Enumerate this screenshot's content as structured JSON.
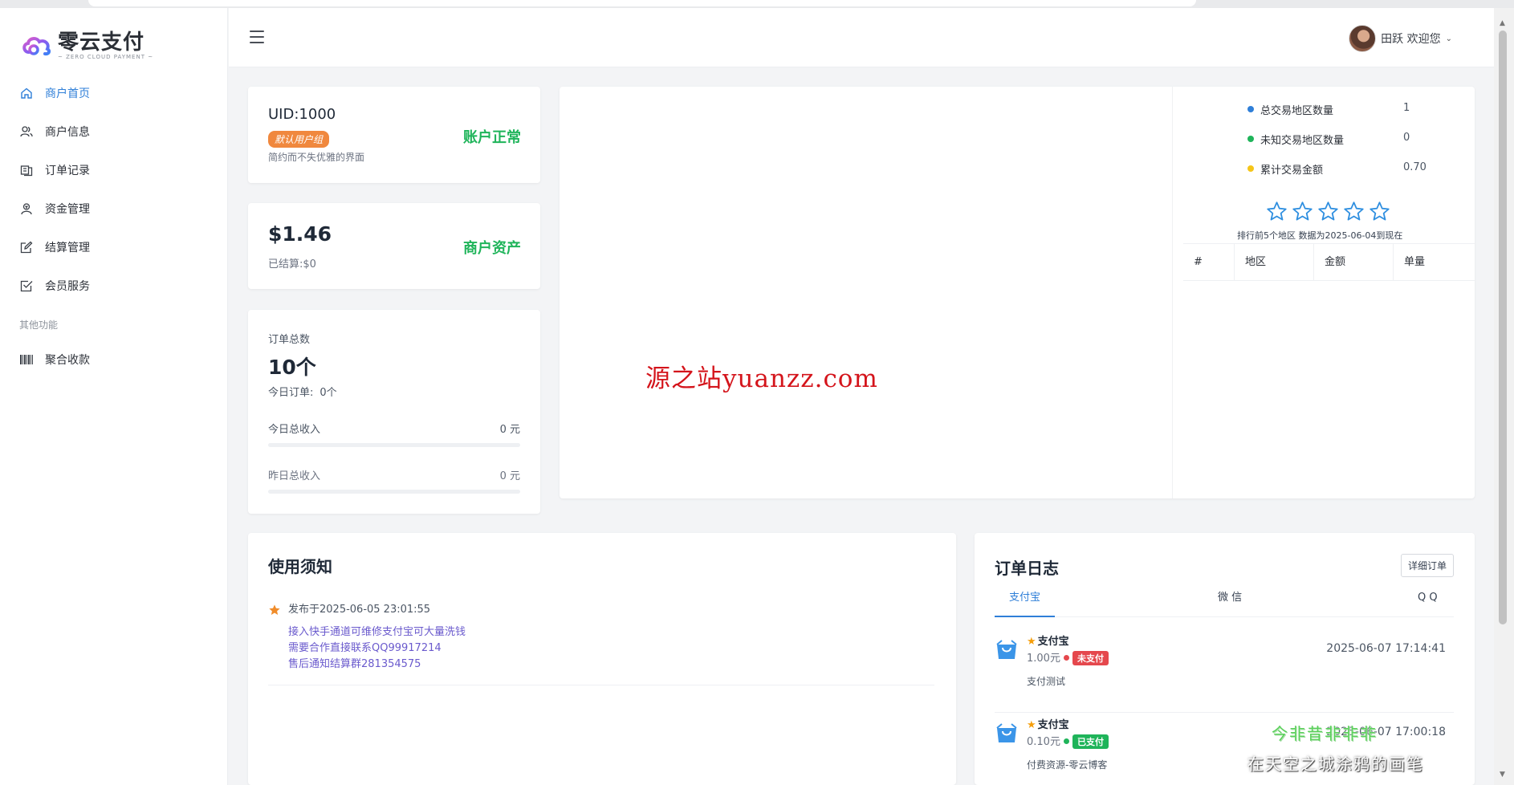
{
  "brand": {
    "name": "零云支付",
    "subtitle": "ZERO CLOUD PAYMENT",
    "accent": "#2f7fd8"
  },
  "sidebar": {
    "items": [
      {
        "label": "商户首页",
        "icon": "home-icon",
        "active": true
      },
      {
        "label": "商户信息",
        "icon": "users-icon"
      },
      {
        "label": "订单记录",
        "icon": "records-icon"
      },
      {
        "label": "资金管理",
        "icon": "funds-icon"
      },
      {
        "label": "结算管理",
        "icon": "edit-icon"
      },
      {
        "label": "会员服务",
        "icon": "checkbox-icon"
      }
    ],
    "section_label": "其他功能",
    "extra_items": [
      {
        "label": "聚合收款",
        "icon": "barcode-icon"
      }
    ]
  },
  "header": {
    "user_greeting": "田跃 欢迎您"
  },
  "account": {
    "uid": "UID:1000",
    "group_badge": "默认用户组",
    "description": "简约而不失优雅的界面",
    "status": "账户正常"
  },
  "asset": {
    "balance": "$1.46",
    "settled": "已结算:$0",
    "label": "商户资产"
  },
  "orders": {
    "total_label": "订单总数",
    "total_value": "10个",
    "today_label": "今日订单:",
    "today_value": "0个",
    "today_income_label": "今日总收入",
    "today_income_value": "0 元",
    "yesterday_income_label": "昨日总收入",
    "yesterday_income_value": "0 元"
  },
  "region_stats": {
    "rows": [
      {
        "label": "总交易地区数量",
        "value": "1",
        "color": "#2f7fd8"
      },
      {
        "label": "未知交易地区数量",
        "value": "0",
        "color": "#1fb45a"
      },
      {
        "label": "累计交易金额",
        "value": "0.70",
        "color": "#f5c518"
      }
    ],
    "rank_note": "排行前5个地区  数据为2025-06-04到现在",
    "table_headers": [
      "#",
      "地区",
      "金额",
      "单量"
    ],
    "star_count": 5
  },
  "watermarks": {
    "site": "源之站yuanzz.com",
    "overlay_1": "今非昔非非非",
    "overlay_2": "在天空之城涂鸦的画笔"
  },
  "notice": {
    "title": "使用须知",
    "date": "发布于2025-06-05 23:01:55",
    "lines": [
      "接入快手通道可维修支付宝可大量洗钱",
      "需要合作直接联系QQ99917214",
      "售后通知结算群281354575"
    ]
  },
  "order_log": {
    "title": "订单日志",
    "detail_button": "详细订单",
    "tabs": [
      "支付宝",
      "微 信",
      "Q Q"
    ],
    "entries": [
      {
        "name": "支付宝",
        "amount": "1.00元",
        "status": "未支付",
        "status_color": "#e5484d",
        "desc": "支付测试",
        "time": "2025-06-07 17:14:41"
      },
      {
        "name": "支付宝",
        "amount": "0.10元",
        "status": "已支付",
        "status_color": "#1fb45a",
        "desc": "付费资源-零云博客",
        "time": "2025-06-07 17:00:18"
      }
    ]
  }
}
